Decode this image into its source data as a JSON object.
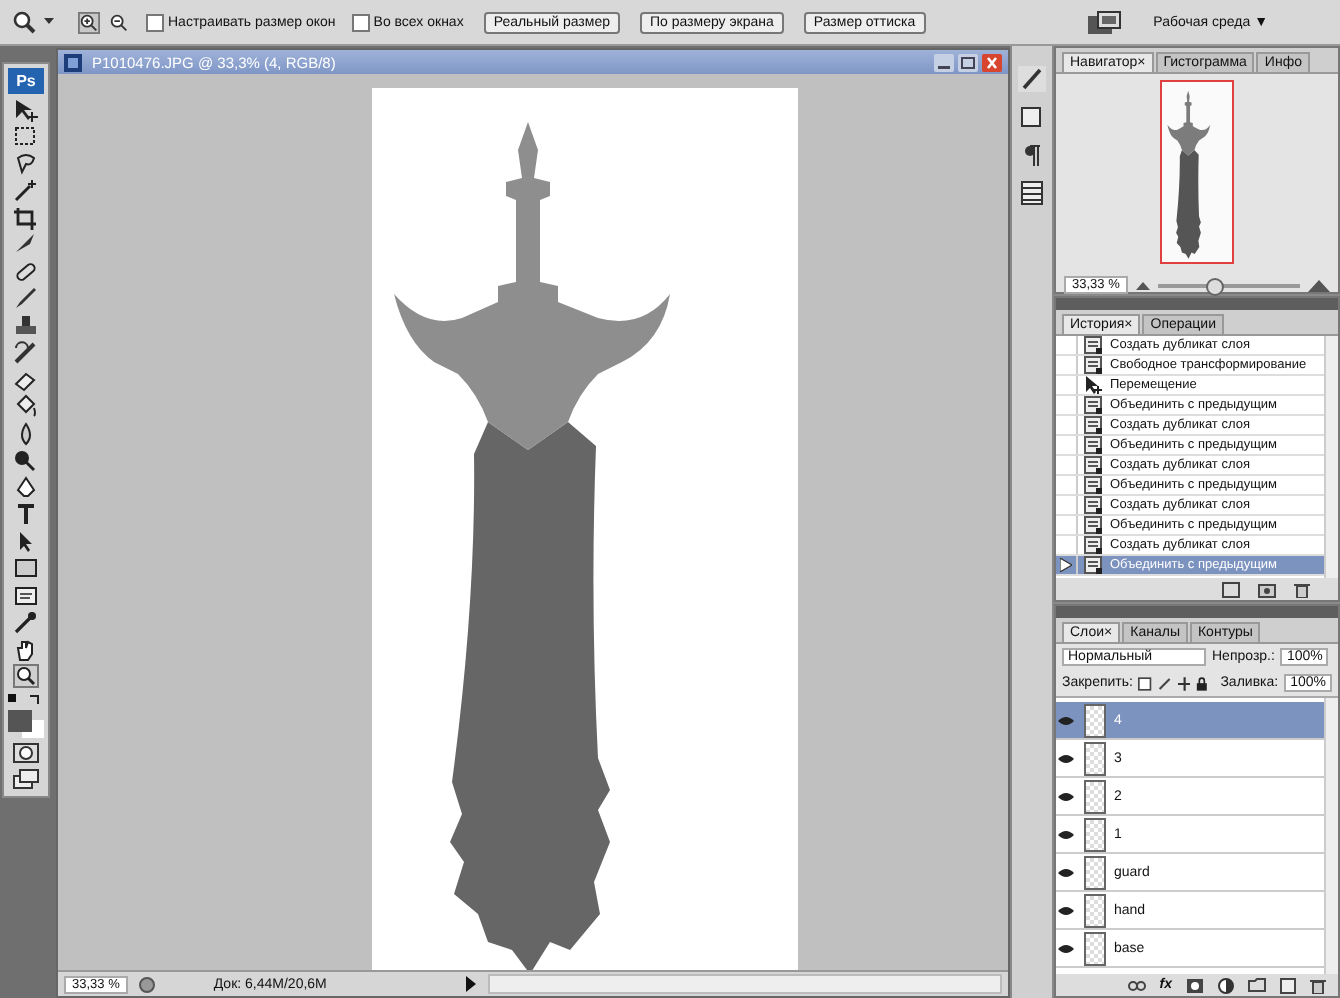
{
  "options_bar": {
    "checkboxes": [
      {
        "label": "Настраивать размер окон",
        "checked": false
      },
      {
        "label": "Во всех окнах",
        "checked": false
      }
    ],
    "buttons": [
      "Реальный размер",
      "По размеру экрана",
      "Размер оттиска"
    ],
    "workspace": "Рабочая среда ▼"
  },
  "toolbox": {
    "logo": "Ps"
  },
  "document": {
    "title": "P1010476.JPG @ 33,3% (4, RGB/8)",
    "zoom": "33,33 %",
    "doc_size": "Док: 6,44M/20,6M"
  },
  "navigator": {
    "tabs": [
      {
        "label": "Навигатор",
        "selected": true
      },
      {
        "label": "Гистограмма",
        "selected": false
      },
      {
        "label": "Инфо",
        "selected": false
      }
    ],
    "close": "×",
    "zoom": "33,33 %",
    "level": 0.4
  },
  "history": {
    "tabs": [
      {
        "label": "История",
        "selected": true
      },
      {
        "label": "Операции",
        "selected": false
      }
    ],
    "close": "×",
    "items": [
      {
        "label": "Создать дубликат слоя",
        "kind": "document",
        "selected": false
      },
      {
        "label": "Свободное трансформирование",
        "kind": "document",
        "selected": false
      },
      {
        "label": "Перемещение",
        "kind": "move",
        "selected": false
      },
      {
        "label": "Объединить с предыдущим",
        "kind": "document",
        "selected": false
      },
      {
        "label": "Создать дубликат слоя",
        "kind": "document",
        "selected": false
      },
      {
        "label": "Объединить с предыдущим",
        "kind": "document",
        "selected": false
      },
      {
        "label": "Создать дубликат слоя",
        "kind": "document",
        "selected": false
      },
      {
        "label": "Объединить с предыдущим",
        "kind": "document",
        "selected": false
      },
      {
        "label": "Создать дубликат слоя",
        "kind": "document",
        "selected": false
      },
      {
        "label": "Объединить с предыдущим",
        "kind": "document",
        "selected": false
      },
      {
        "label": "Создать дубликат слоя",
        "kind": "document",
        "selected": false
      },
      {
        "label": "Объединить с предыдущим",
        "kind": "document",
        "selected": true
      }
    ]
  },
  "layers": {
    "tabs": [
      {
        "label": "Слои",
        "selected": true
      },
      {
        "label": "Каналы",
        "selected": false
      },
      {
        "label": "Контуры",
        "selected": false
      }
    ],
    "close": "×",
    "blend_mode": "Нормальный",
    "opacity_label": "Непрозр.:",
    "opacity": "100%",
    "lock_label": "Закрепить:",
    "fill_label": "Заливка:",
    "fill": "100%",
    "effects": "fx",
    "items": [
      {
        "name": "4",
        "visible": true,
        "selected": true
      },
      {
        "name": "3",
        "visible": true,
        "selected": false
      },
      {
        "name": "2",
        "visible": true,
        "selected": false
      },
      {
        "name": "1",
        "visible": true,
        "selected": false
      },
      {
        "name": "guard",
        "visible": true,
        "selected": false
      },
      {
        "name": "hand",
        "visible": true,
        "selected": false
      },
      {
        "name": "base",
        "visible": true,
        "selected": false
      }
    ]
  }
}
